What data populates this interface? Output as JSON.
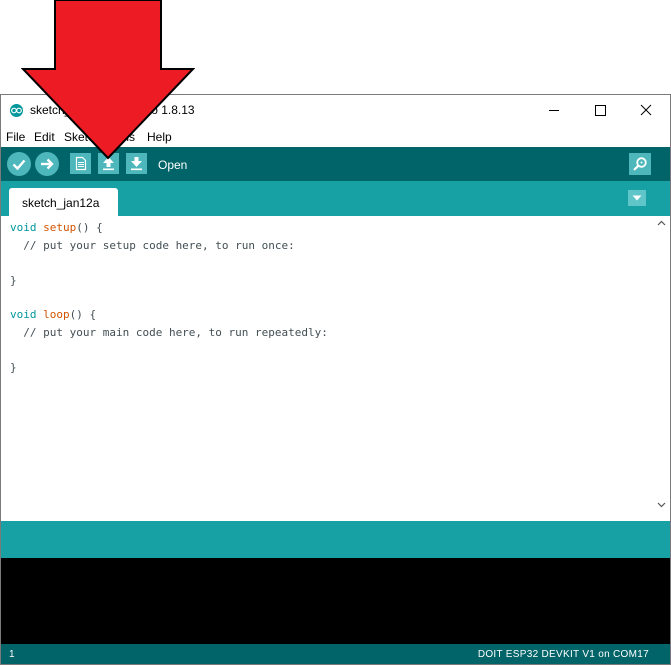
{
  "window": {
    "title": "sketch_jan12a | Arduino 1.8.13",
    "controls": [
      "minimize",
      "maximize",
      "close"
    ]
  },
  "menu": {
    "items": [
      "File",
      "Edit",
      "Sketch",
      "Tools",
      "Help"
    ]
  },
  "toolbar": {
    "buttons": [
      "verify",
      "upload",
      "new",
      "open",
      "save"
    ],
    "hover_label": "Open",
    "serial_monitor": "serial-monitor"
  },
  "tabs": [
    {
      "label": "sketch_jan12a",
      "active": true
    }
  ],
  "editor": {
    "lines": [
      "void setup() {",
      "  // put your setup code here, to run once:",
      "",
      "}",
      "",
      "void loop() {",
      "  // put your main code here, to run repeatedly:",
      "",
      "}"
    ]
  },
  "footer": {
    "line_number": "1",
    "board": "DOIT ESP32 DEVKIT V1 on COM17"
  },
  "colors": {
    "toolbar_bg": "#006468",
    "tabbar_bg": "#17a1a5",
    "button": "#4db7bb",
    "keyword": "#00979c",
    "function": "#d35400",
    "arrow": "#ed1c24"
  }
}
